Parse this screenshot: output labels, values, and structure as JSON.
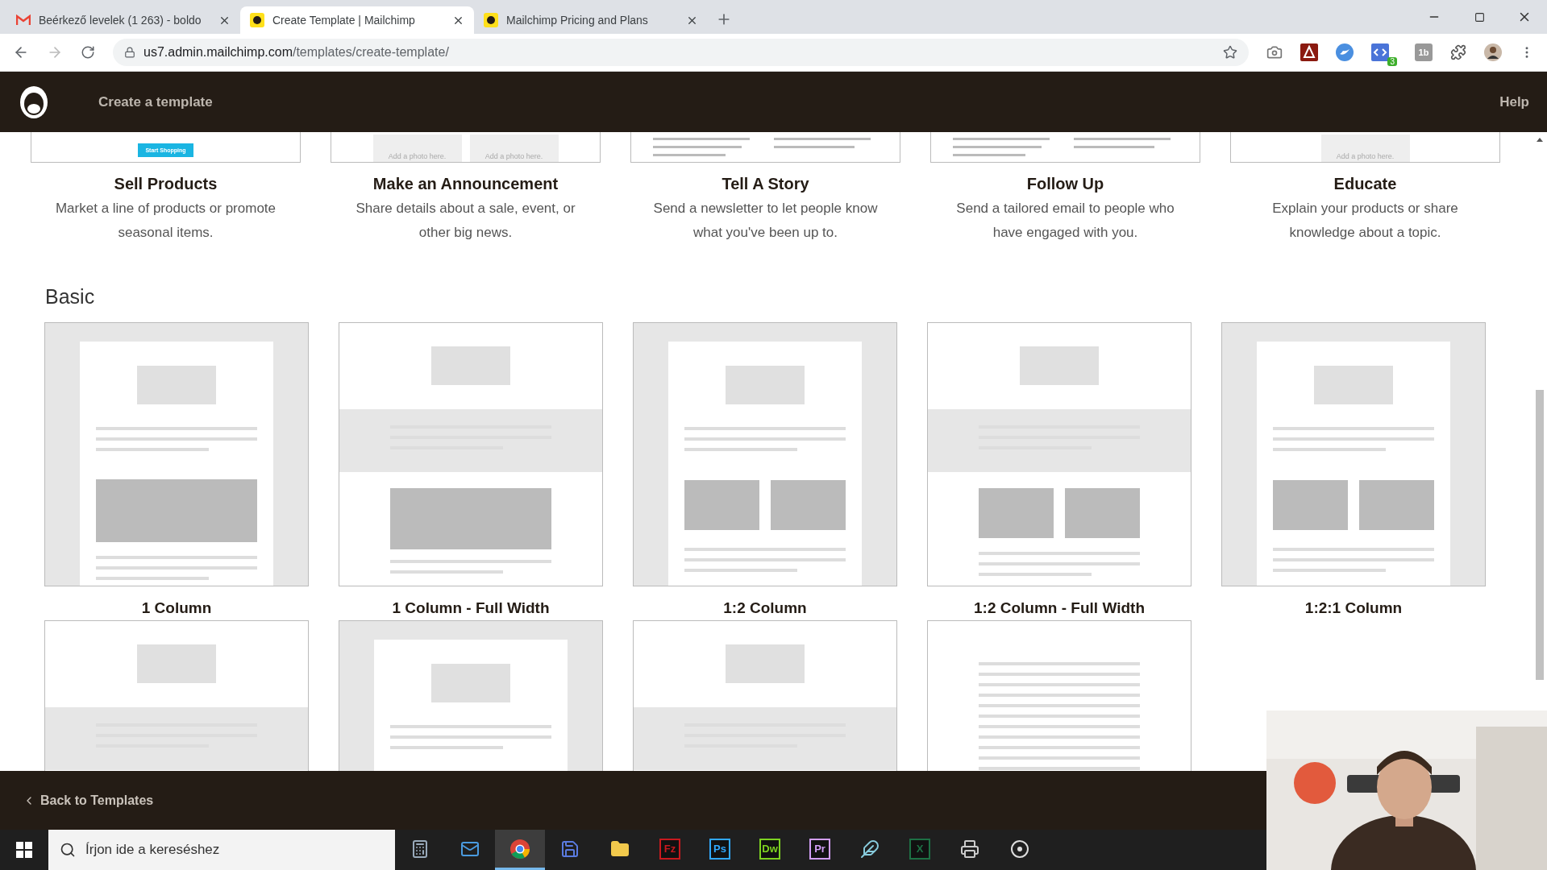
{
  "browser": {
    "tabs": [
      {
        "title": "Beérkező levelek (1 263) - boldo",
        "kind": "gmail",
        "selected": false
      },
      {
        "title": "Create Template | Mailchimp",
        "kind": "chimp",
        "selected": true
      },
      {
        "title": "Mailchimp Pricing and Plans",
        "kind": "chimp",
        "selected": false
      }
    ],
    "url_host": "us7.admin.mailchimp.com",
    "url_path": "/templates/create-template/",
    "extensions": [
      {
        "kind": "camera"
      },
      {
        "kind": "acrobat"
      },
      {
        "kind": "bird"
      },
      {
        "kind": "code",
        "badge": "3"
      },
      {
        "kind": "text",
        "label": "1b"
      },
      {
        "kind": "puzzle"
      },
      {
        "kind": "avatar"
      }
    ]
  },
  "header": {
    "title": "Create a template",
    "help": "Help"
  },
  "featured": [
    {
      "title": "Sell Products",
      "description": "Market a line of products or promote seasonal items.",
      "preview": {
        "kind": "button",
        "texts": [
          "Start Shopping"
        ]
      }
    },
    {
      "title": "Make an Announcement",
      "description": "Share details about a sale, event, or other big news.",
      "preview": {
        "kind": "photos",
        "texts": [
          "Add a photo here.",
          "Add a photo here."
        ]
      }
    },
    {
      "title": "Tell A Story",
      "description": "Send a newsletter to let people know what you've been up to.",
      "preview": {
        "kind": "lines"
      }
    },
    {
      "title": "Follow Up",
      "description": "Send a tailored email to people who have engaged with you.",
      "preview": {
        "kind": "lines"
      }
    },
    {
      "title": "Educate",
      "description": "Explain your products or share knowledge about a topic.",
      "preview": {
        "kind": "photos",
        "texts": [
          "Add a photo here."
        ]
      }
    }
  ],
  "basic": {
    "title": "Basic",
    "templates": [
      {
        "title": "1 Column",
        "kind": "boxed"
      },
      {
        "title": "1 Column - Full Width",
        "kind": "full"
      },
      {
        "title": "1:2 Column",
        "kind": "boxed"
      },
      {
        "title": "1:2 Column - Full Width",
        "kind": "full"
      },
      {
        "title": "1:2:1 Column",
        "kind": "boxed"
      },
      {
        "kind": "full"
      },
      {
        "kind": "boxed"
      },
      {
        "kind": "full"
      },
      {
        "kind": "text"
      }
    ]
  },
  "footer": {
    "back": "Back to Templates"
  },
  "taskbar": {
    "search_placeholder": "Írjon ide a kereséshez",
    "apps": [
      {
        "kind": "calculator",
        "selected": false
      },
      {
        "kind": "mail",
        "selected": false
      },
      {
        "kind": "chrome",
        "selected": true
      },
      {
        "kind": "disk",
        "selected": false
      },
      {
        "kind": "folder",
        "selected": false
      },
      {
        "kind": "label",
        "label": "Fz",
        "color": "#c8191e",
        "selected": false
      },
      {
        "kind": "label",
        "label": "Ps",
        "color": "#31a8ff",
        "selected": false
      },
      {
        "kind": "label",
        "label": "Dw",
        "color": "#7ed321",
        "selected": false
      },
      {
        "kind": "label",
        "label": "Pr",
        "color": "#d29ef7",
        "selected": false
      },
      {
        "kind": "pen",
        "selected": false
      },
      {
        "kind": "label",
        "label": "X",
        "color": "#1d7044",
        "selected": false
      },
      {
        "kind": "printer",
        "selected": false
      },
      {
        "kind": "obs",
        "selected": false
      }
    ]
  }
}
